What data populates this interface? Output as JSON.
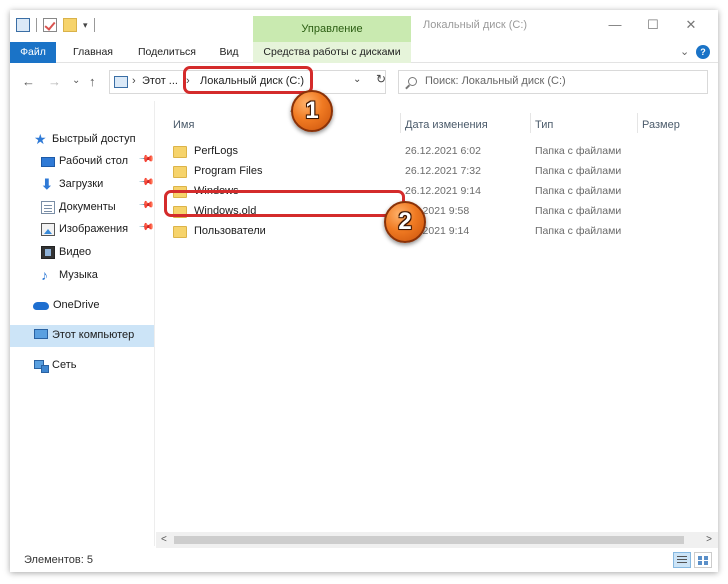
{
  "window": {
    "title": "Локальный диск (C:)",
    "contextual_tab_header": "Управление",
    "controls": {
      "minimize": "—",
      "maximize": "☐",
      "close": "✕"
    }
  },
  "quick_access_toolbar": {
    "dropdown_glyph": "▾"
  },
  "ribbon": {
    "tabs": [
      {
        "label": "Файл"
      },
      {
        "label": "Главная"
      },
      {
        "label": "Поделиться"
      },
      {
        "label": "Вид"
      },
      {
        "label": "Средства работы с дисками"
      }
    ],
    "expand_glyph": "⌄",
    "help_glyph": "?"
  },
  "navigation": {
    "back_glyph": "←",
    "forward_glyph": "→",
    "recent_glyph": "⌄",
    "up_glyph": "↑"
  },
  "address": {
    "separator": "›",
    "crumbs": [
      "Этот ...",
      "Локальный диск (C:)"
    ],
    "dropdown_glyph": "⌄",
    "refresh_glyph": "↻"
  },
  "search": {
    "placeholder": "Поиск: Локальный диск (C:)"
  },
  "nav_pane": {
    "items": [
      {
        "label": "Быстрый доступ",
        "icon": "star-icon"
      },
      {
        "label": "Рабочий стол",
        "icon": "desktop-icon",
        "pinned": true
      },
      {
        "label": "Загрузки",
        "icon": "download-icon",
        "pinned": true
      },
      {
        "label": "Документы",
        "icon": "documents-icon",
        "pinned": true
      },
      {
        "label": "Изображения",
        "icon": "pictures-icon",
        "pinned": true
      },
      {
        "label": "Видео",
        "icon": "video-icon"
      },
      {
        "label": "Музыка",
        "icon": "music-icon"
      },
      {
        "label": "OneDrive",
        "icon": "cloud-icon"
      },
      {
        "label": "Этот компьютер",
        "icon": "computer-icon",
        "selected": true
      },
      {
        "label": "Сеть",
        "icon": "network-icon"
      }
    ],
    "pin_glyph": "📌"
  },
  "columns": {
    "name": "Имя",
    "date": "Дата изменения",
    "type": "Тип",
    "size": "Размер",
    "sort_glyph": "^"
  },
  "files": [
    {
      "name": "PerfLogs",
      "date": "26.12.2021 6:02",
      "type": "Папка с файлами"
    },
    {
      "name": "Program Files",
      "date": "26.12.2021 7:32",
      "type": "Папка с файлами"
    },
    {
      "name": "Windows",
      "date": "26.12.2021 9:14",
      "type": "Папка с файлами"
    },
    {
      "name": "Windows.old",
      "date": ".12.2021 9:58",
      "type": "Папка с файлами"
    },
    {
      "name": "Пользователи",
      "date": ".12.2021 9:14",
      "type": "Папка с файлами"
    }
  ],
  "scrollbar": {
    "left_glyph": "<",
    "right_glyph": ">"
  },
  "status": {
    "items_count": "Элементов: 5"
  },
  "annotations": {
    "colors": {
      "highlight": "#d42b2b",
      "badge": "#f07a22"
    },
    "badges": [
      "1",
      "2"
    ]
  }
}
